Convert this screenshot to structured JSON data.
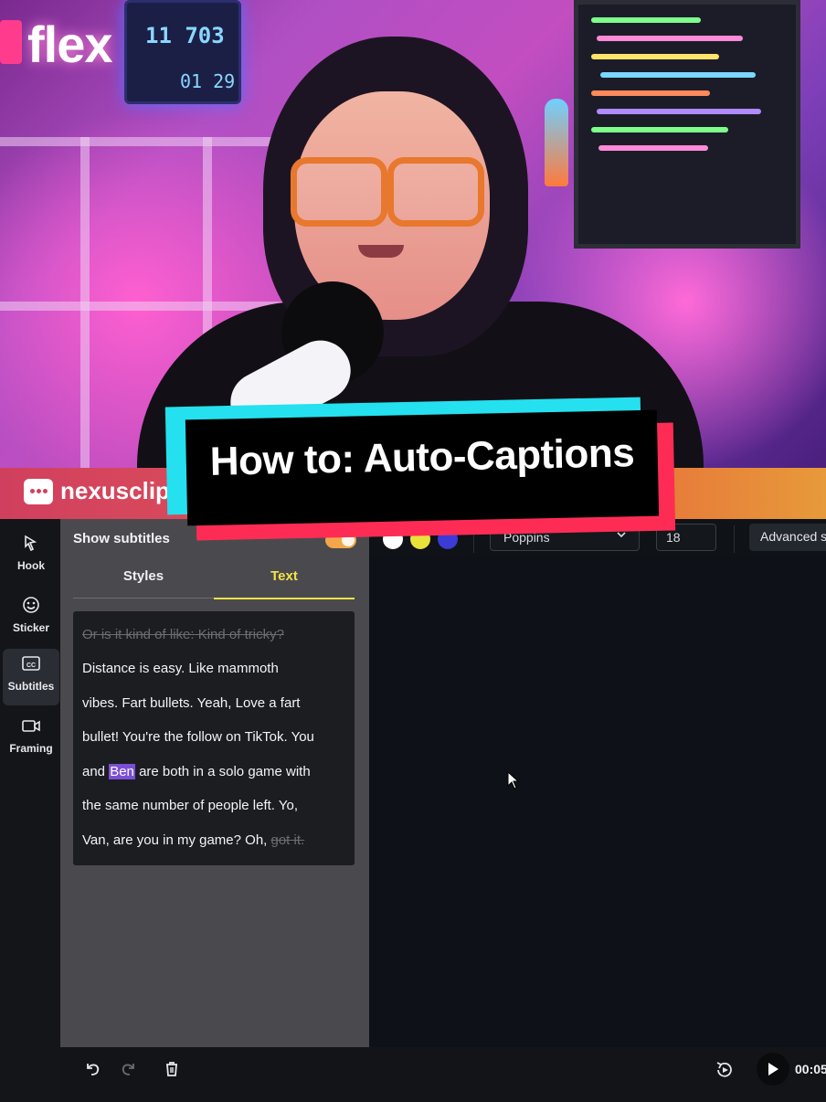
{
  "overlay": {
    "title": "How to: Auto-Captions"
  },
  "background": {
    "sign_text": "flex",
    "counter_top": "11 703",
    "counter_bottom": "01 29"
  },
  "app": {
    "name": "nexusclip"
  },
  "rail": [
    {
      "label": "Hook",
      "icon": "hook-icon"
    },
    {
      "label": "Sticker",
      "icon": "sticker-icon"
    },
    {
      "label": "Subtitles",
      "icon": "subtitles-icon"
    },
    {
      "label": "Framing",
      "icon": "framing-icon"
    }
  ],
  "panel": {
    "show_subtitles_label": "Show subtitles",
    "show_subtitles_on": true,
    "tabs": [
      "Styles",
      "Text"
    ],
    "active_tab": "Text",
    "transcript": {
      "line1": "Or is it kind of like: Kind of tricky?",
      "line2": "Distance is easy. Like mammoth",
      "line3": "vibes. Fart bullets. Yeah, Love a fart",
      "line4": "bullet! You're the follow on TikTok. You",
      "line5_before": "and ",
      "line5_highlight": "Ben",
      "line5_after": " are both in a solo game with",
      "line6": "the same number of people left. Yo,",
      "line7_main": "Van, are you in my game? Oh, ",
      "line7_struck": "got it."
    }
  },
  "toolbar": {
    "colors": [
      "#ffffff",
      "#e8e23a",
      "#3b3bd6"
    ],
    "font": "Poppins",
    "font_size": "18",
    "advanced_label": "Advanced s"
  },
  "player": {
    "timecode": "00:05"
  },
  "colors": {
    "accent_yellow": "#f3e24a",
    "toggle_on": "#f3a64a",
    "highlight": "#7a4fd6",
    "brand_red": "#fe2c55",
    "brand_cyan": "#25e0ee"
  }
}
